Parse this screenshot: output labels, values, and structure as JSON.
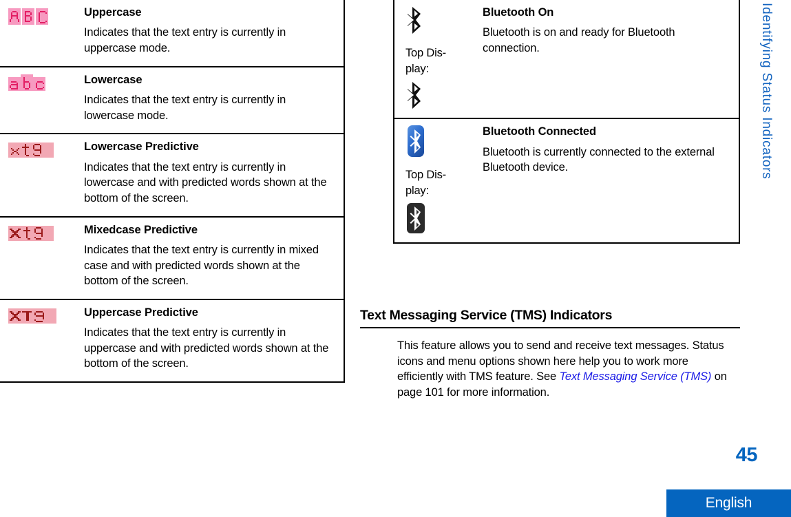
{
  "left_table": {
    "rows": [
      {
        "icon": "abc-uppercase-pixel-icon",
        "icon_text": "ABC",
        "title": "Uppercase",
        "desc": "Indicates that the text entry is currently in uppercase mode."
      },
      {
        "icon": "abc-lowercase-pixel-icon",
        "icon_text": "abc",
        "title": "Lowercase",
        "desc": "Indicates that the text entry is currently in lowercase mode."
      },
      {
        "icon": "xt9-lowercase-predictive-icon",
        "icon_text": "xt9",
        "title": "Lowercase Predictive",
        "desc": "Indicates that the text entry is currently in lowercase and with predicted words shown at the bottom of the screen."
      },
      {
        "icon": "xt9-mixedcase-predictive-icon",
        "icon_text": "Xt9",
        "title": "Mixedcase Predictive",
        "desc": "Indicates that the text entry is currently in mixed case and with predicted words shown at the bottom of the screen."
      },
      {
        "icon": "xt9-uppercase-predictive-icon",
        "icon_text": "XT9",
        "title": "Uppercase Predictive",
        "desc": "Indicates that the text entry is currently in uppercase and with predicted words shown at the bottom of the screen."
      }
    ]
  },
  "right_table": {
    "rows": [
      {
        "icon": "bluetooth-on-icon",
        "top_display_label": "Top Dis-play:",
        "top_display_icon": "bluetooth-on-top-display-icon",
        "title": "Bluetooth On",
        "desc": "Bluetooth is on and ready for Bluetooth connection."
      },
      {
        "icon": "bluetooth-connected-icon",
        "top_display_label": "Top Dis-play:",
        "top_display_icon": "bluetooth-connected-top-display-icon",
        "title": "Bluetooth Connected",
        "desc": "Bluetooth is currently connected to the external Bluetooth device."
      }
    ]
  },
  "tms_section": {
    "heading": "Text Messaging Service (TMS) Indicators",
    "body_before": "This feature allows you to send and receive text messages. Status icons and menu options shown here help you to work more efficiently with TMS feature. See ",
    "xref": "Text Messaging Service (TMS)",
    "body_after": " on page 101 for more information."
  },
  "side_tab": {
    "label": "Identifying Status Indicators"
  },
  "footer": {
    "page_number": "45",
    "language": "English"
  },
  "colors": {
    "accent_blue": "#0565bf",
    "side_tab_blue": "#1565c0",
    "xref_blue": "#1a1ae6",
    "pixel_pink_outline": "#f79ac0",
    "pixel_pink_fill": "#e31e64",
    "pixel_lightpink_bg": "#f2a8b4",
    "pixel_darkred": "#9b1b1b",
    "bluetooth_blue": "#2f6fd0",
    "bluetooth_dark": "#2b2b2b"
  }
}
